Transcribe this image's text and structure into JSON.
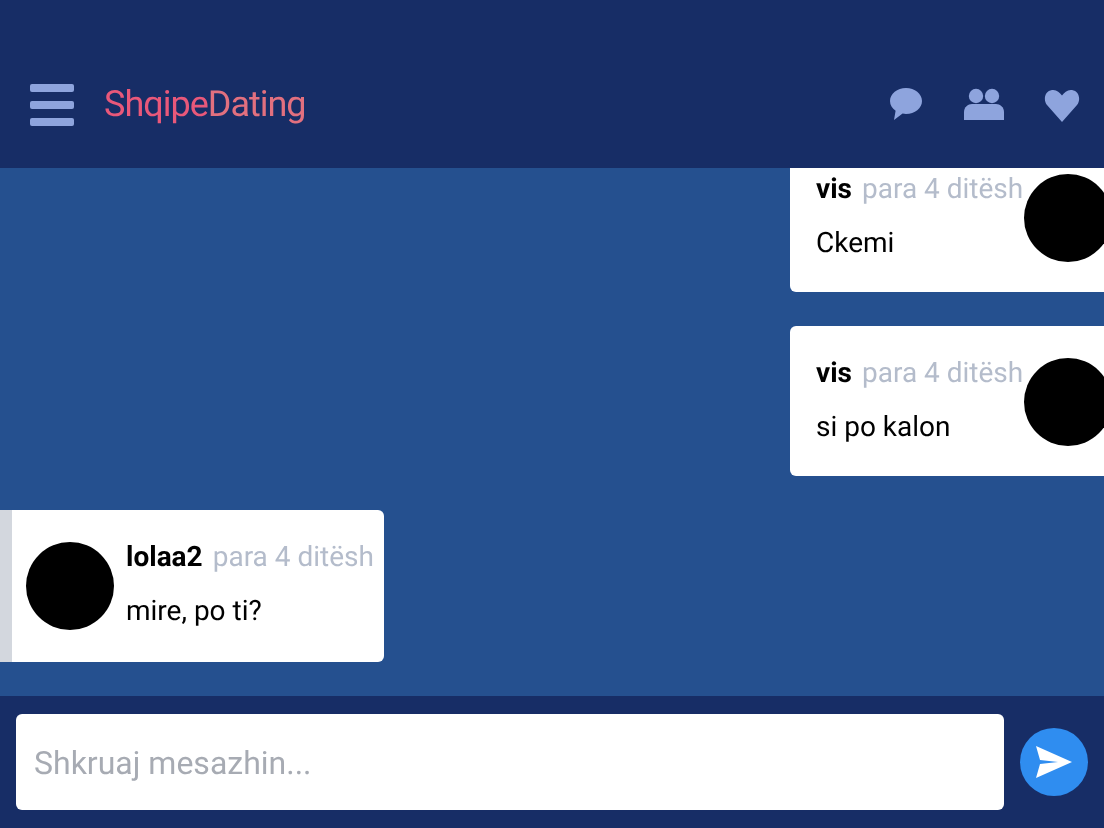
{
  "header": {
    "logo": {
      "first": "Shqipe",
      "second": "Dating"
    }
  },
  "messages": [
    {
      "kind": "outgoing",
      "name": "vis",
      "time": "para 4 ditësh",
      "text": "Ckemi"
    },
    {
      "kind": "outgoing",
      "name": "vis",
      "time": "para 4 ditësh",
      "text": "si po kalon"
    },
    {
      "kind": "incoming",
      "name": "lolaa2",
      "time": "para 4 ditësh",
      "text": "mire, po ti?"
    }
  ],
  "composer": {
    "placeholder": "Shkruaj mesazhin..."
  }
}
